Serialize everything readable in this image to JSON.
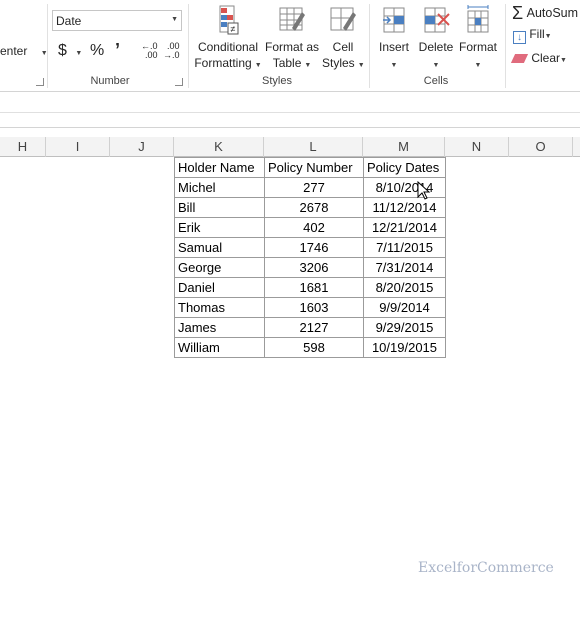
{
  "ribbon": {
    "alignment": {
      "merge_center_partial": "enter"
    },
    "number": {
      "format_value": "Date",
      "currency_symbol": "$",
      "percent_symbol": "%",
      "comma_symbol": "’",
      "inc_decimal_top": "←.0",
      "inc_decimal_bottom": ".00",
      "dec_decimal_top": ".00",
      "dec_decimal_bottom": "→.0",
      "group_label": "Number"
    },
    "styles": {
      "conditional_line1": "Conditional",
      "conditional_line2": "Formatting",
      "format_table_line1": "Format as",
      "format_table_line2": "Table",
      "cell_styles_line1": "Cell",
      "cell_styles_line2": "Styles",
      "group_label": "Styles"
    },
    "cells": {
      "insert_label": "Insert",
      "delete_label": "Delete",
      "format_label": "Format",
      "group_label": "Cells"
    },
    "editing": {
      "autosum_label": "AutoSum",
      "fill_label": "Fill",
      "clear_label": "Clear"
    }
  },
  "columns": [
    "H",
    "I",
    "J",
    "K",
    "L",
    "M",
    "N",
    "O"
  ],
  "table": {
    "headers": [
      "Holder Name",
      "Policy Number",
      "Policy Dates"
    ],
    "rows": [
      [
        "Michel",
        "277",
        "8/10/2014"
      ],
      [
        "Bill",
        "2678",
        "11/12/2014"
      ],
      [
        "Erik",
        "402",
        "12/21/2014"
      ],
      [
        "Samual",
        "1746",
        "7/11/2015"
      ],
      [
        "George",
        "3206",
        "7/31/2014"
      ],
      [
        "Daniel",
        "1681",
        "8/20/2015"
      ],
      [
        "Thomas",
        "1603",
        "9/9/2014"
      ],
      [
        "James",
        "2127",
        "9/29/2015"
      ],
      [
        "William",
        "598",
        "10/19/2015"
      ]
    ]
  },
  "watermark": "ExcelforCommerce"
}
